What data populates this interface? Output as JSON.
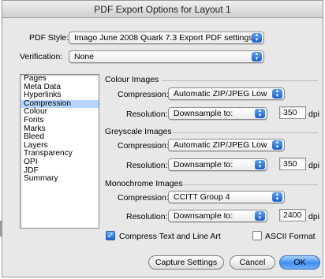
{
  "window": {
    "title": "PDF Export Options for Layout 1"
  },
  "pdf_style": {
    "label": "PDF Style:",
    "value": "Imago June 2008 Quark 7.3 Export PDF settings"
  },
  "verification": {
    "label": "Verification:",
    "value": "None"
  },
  "sidebar": {
    "items": [
      {
        "label": "Pages"
      },
      {
        "label": "Meta Data"
      },
      {
        "label": "Hyperlinks"
      },
      {
        "label": "Compression",
        "selected": true
      },
      {
        "label": "Colour"
      },
      {
        "label": "Fonts"
      },
      {
        "label": "Marks"
      },
      {
        "label": "Bleed"
      },
      {
        "label": "Layers"
      },
      {
        "label": "Transparency"
      },
      {
        "label": "OPI"
      },
      {
        "label": "JDF"
      },
      {
        "label": "Summary"
      }
    ]
  },
  "colour_images": {
    "title": "Colour Images",
    "compression_label": "Compression:",
    "compression": "Automatic ZIP/JPEG Low",
    "resolution_label": "Resolution:",
    "resolution": "Downsample to:",
    "dpi_value": "350",
    "dpi_unit": "dpi"
  },
  "greyscale_images": {
    "title": "Greyscale Images",
    "compression_label": "Compression:",
    "compression": "Automatic ZIP/JPEG Low",
    "resolution_label": "Resolution:",
    "resolution": "Downsample to:",
    "dpi_value": "350",
    "dpi_unit": "dpi"
  },
  "monochrome_images": {
    "title": "Monochrome Images",
    "compression_label": "Compression:",
    "compression": "CCITT Group 4",
    "resolution_label": "Resolution:",
    "resolution": "Downsample to:",
    "dpi_value": "2400",
    "dpi_unit": "dpi"
  },
  "options": {
    "compress_text_label": "Compress Text and Line Art",
    "compress_text_checked": true,
    "ascii_label": "ASCII Format",
    "ascii_checked": false
  },
  "buttons": {
    "capture": "Capture Settings",
    "cancel": "Cancel",
    "ok": "OK"
  },
  "colors": {
    "accent": "#3f8ef0",
    "selection": "#b5d5ff"
  }
}
